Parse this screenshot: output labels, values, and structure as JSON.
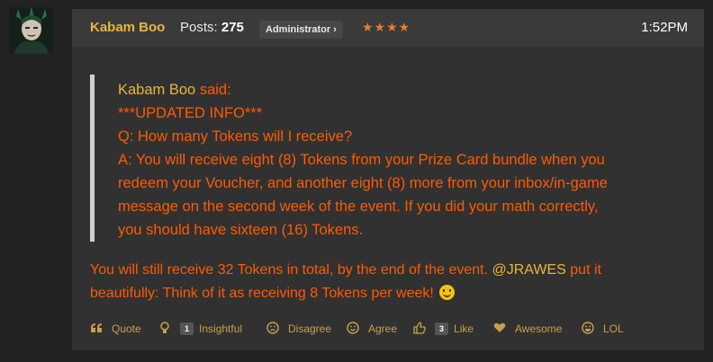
{
  "post": {
    "author": "Kabam Boo",
    "posts_label": "Posts:",
    "posts_count": "275",
    "role": "Administrator ›",
    "stars": "★★★★",
    "time": "1:52PM"
  },
  "quote": {
    "name": "Kabam Boo",
    "said": " said:",
    "lines": [
      "***UPDATED INFO***",
      "Q: How many Tokens will I receive?",
      "A: You will receive eight (8) Tokens from your Prize Card bundle when you",
      "redeem your Voucher, and another eight (8) more from your inbox/in-game",
      "message on the second week of the event. If you did your math correctly,",
      "you should have sixteen (16) Tokens."
    ]
  },
  "body": {
    "line1_pre": "You will still receive 32 Tokens in total, by the end of the event. ",
    "mention": "@JRAWES",
    "line1_post": " put it",
    "line2": "beautifully: Think of it as receiving 8 Tokens per week! "
  },
  "reactions": [
    {
      "icon": "quote-icon",
      "label": "Quote",
      "count": ""
    },
    {
      "icon": "lightbulb-icon",
      "label": "Insightful",
      "count": "1"
    },
    {
      "icon": "frown-icon",
      "label": "Disagree",
      "count": ""
    },
    {
      "icon": "smile-icon",
      "label": "Agree",
      "count": ""
    },
    {
      "icon": "thumbs-up-icon",
      "label": "Like",
      "count": "3"
    },
    {
      "icon": "heart-icon",
      "label": "Awesome",
      "count": ""
    },
    {
      "icon": "laugh-icon",
      "label": "LOL",
      "count": ""
    }
  ],
  "colors": {
    "username": "#e7b63c",
    "post_text": "#ff5a00",
    "stars": "#e47d2e",
    "background": "#222222",
    "post_bg": "#313131"
  }
}
